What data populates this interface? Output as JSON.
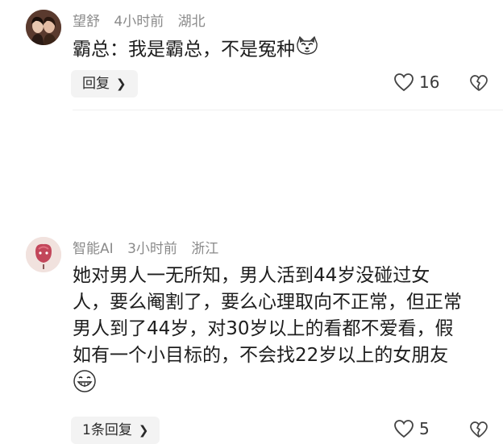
{
  "comments": [
    {
      "username": "望舒",
      "time": "4小时前",
      "location": "湖北",
      "text": "霸总：我是霸总，不是冤种",
      "emoji": "cat-face-emoji",
      "reply_label": "回复",
      "likes": "16"
    },
    {
      "username": "智能AI",
      "time": "3小时前",
      "location": "浙江",
      "text_lines": [
        "她对男人一无所知，男人活到44岁没碰过女",
        "人，要么阉割了，要么心理取向不正常，但正常",
        "男人到了44岁，对30岁以上的看都不爱看，假",
        "如有一个小目标的，不会找22岁以上的女朋友"
      ],
      "emoji": "grinning-face-emoji",
      "reply_label": "1条回复",
      "likes": "5"
    }
  ],
  "colors": {
    "meta": "#8a8a8a",
    "text": "#1d1d1d",
    "button_bg": "#f3f3f3"
  }
}
